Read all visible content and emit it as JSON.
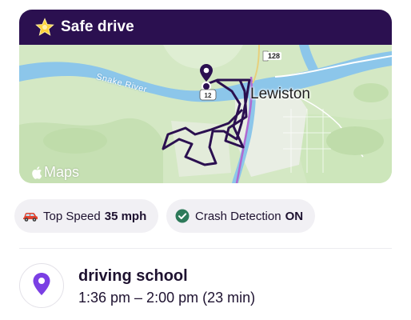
{
  "card": {
    "title": "Safe drive",
    "icon": "star-icon"
  },
  "map": {
    "river_label": "Snake River",
    "city_label": "Lewiston",
    "route_number": "128",
    "maps_logo_text": "Maps",
    "route_color": "#2b1050",
    "water_color": "#8cc6ea",
    "land_color": "#d4e8c4"
  },
  "stats": {
    "top_speed_label": "Top Speed",
    "top_speed_value": "35 mph",
    "top_speed_icon": "car-icon",
    "crash_label": "Crash Detection",
    "crash_value": "ON",
    "crash_icon": "check-circle-icon"
  },
  "place": {
    "icon": "location-pin-icon",
    "name": "driving school",
    "time": "1:36 pm – 2:00 pm (23 min)",
    "accent_color": "#7b3fe4"
  }
}
